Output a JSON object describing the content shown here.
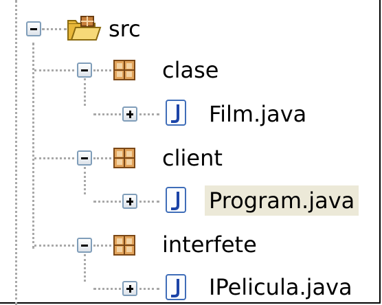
{
  "tree": {
    "root": {
      "label": "src",
      "icon": "folder-package-icon",
      "expanded": true
    },
    "packages": [
      {
        "label": "clase",
        "icon": "package-icon",
        "expanded": true,
        "files": [
          {
            "label": "Film.java",
            "icon": "java-file-icon",
            "expanded": false
          }
        ]
      },
      {
        "label": "client",
        "icon": "package-icon",
        "expanded": true,
        "files": [
          {
            "label": "Program.java",
            "icon": "java-file-icon",
            "expanded": false,
            "selected": true
          }
        ]
      },
      {
        "label": "interfete",
        "icon": "package-icon",
        "expanded": true,
        "files": [
          {
            "label": "IPelicula.java",
            "icon": "java-file-icon",
            "expanded": false
          }
        ]
      }
    ]
  },
  "colors": {
    "selection": "#ece9d8",
    "toggle_border": "#7f9db9",
    "tree_lines": "#a8a8a8",
    "package_orange": "#c8803c"
  }
}
